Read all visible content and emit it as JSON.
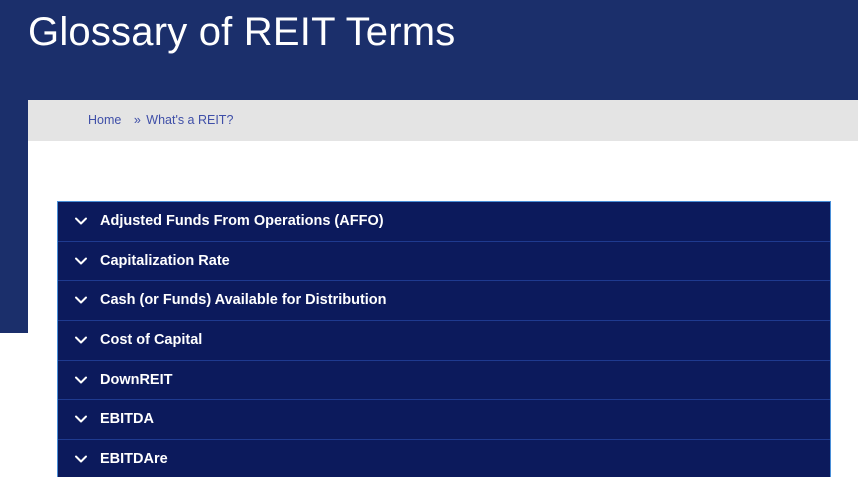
{
  "header": {
    "title": "Glossary of REIT Terms"
  },
  "breadcrumb": {
    "home_label": "Home",
    "separator": "»",
    "current_label": "What's a REIT?"
  },
  "glossary": {
    "items": [
      {
        "label": "Adjusted Funds From Operations (AFFO)",
        "icon": "chevron-down-icon"
      },
      {
        "label": "Capitalization Rate",
        "icon": "chevron-down-icon"
      },
      {
        "label": "Cash (or Funds) Available for Distribution",
        "icon": "chevron-down-icon"
      },
      {
        "label": "Cost of Capital",
        "icon": "chevron-down-icon"
      },
      {
        "label": "DownREIT",
        "icon": "chevron-down-icon"
      },
      {
        "label": "EBITDA",
        "icon": "chevron-down-icon"
      },
      {
        "label": "EBITDAre",
        "icon": "chevron-down-icon"
      }
    ]
  },
  "colors": {
    "header_bg": "#1b2f6b",
    "accordion_bg": "#0c1a5c",
    "breadcrumb_bg": "#e4e4e4",
    "link": "#3f4fa8"
  }
}
